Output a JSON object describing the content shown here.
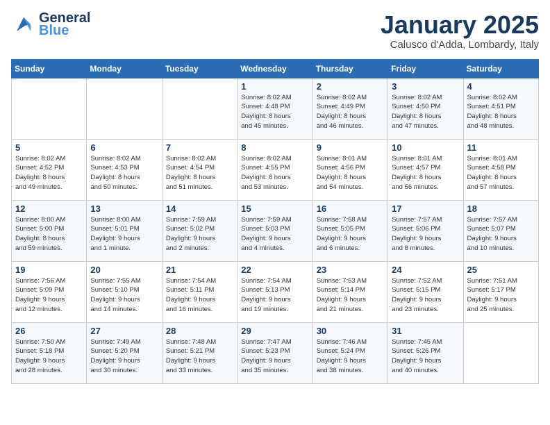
{
  "logo": {
    "line1": "General",
    "line2": "Blue",
    "bird_icon": "bird-icon"
  },
  "header": {
    "month": "January 2025",
    "location": "Calusco d'Adda, Lombardy, Italy"
  },
  "weekdays": [
    "Sunday",
    "Monday",
    "Tuesday",
    "Wednesday",
    "Thursday",
    "Friday",
    "Saturday"
  ],
  "weeks": [
    [
      {
        "day": "",
        "info": ""
      },
      {
        "day": "",
        "info": ""
      },
      {
        "day": "",
        "info": ""
      },
      {
        "day": "1",
        "info": "Sunrise: 8:02 AM\nSunset: 4:48 PM\nDaylight: 8 hours\nand 45 minutes."
      },
      {
        "day": "2",
        "info": "Sunrise: 8:02 AM\nSunset: 4:49 PM\nDaylight: 8 hours\nand 46 minutes."
      },
      {
        "day": "3",
        "info": "Sunrise: 8:02 AM\nSunset: 4:50 PM\nDaylight: 8 hours\nand 47 minutes."
      },
      {
        "day": "4",
        "info": "Sunrise: 8:02 AM\nSunset: 4:51 PM\nDaylight: 8 hours\nand 48 minutes."
      }
    ],
    [
      {
        "day": "5",
        "info": "Sunrise: 8:02 AM\nSunset: 4:52 PM\nDaylight: 8 hours\nand 49 minutes."
      },
      {
        "day": "6",
        "info": "Sunrise: 8:02 AM\nSunset: 4:53 PM\nDaylight: 8 hours\nand 50 minutes."
      },
      {
        "day": "7",
        "info": "Sunrise: 8:02 AM\nSunset: 4:54 PM\nDaylight: 8 hours\nand 51 minutes."
      },
      {
        "day": "8",
        "info": "Sunrise: 8:02 AM\nSunset: 4:55 PM\nDaylight: 8 hours\nand 53 minutes."
      },
      {
        "day": "9",
        "info": "Sunrise: 8:01 AM\nSunset: 4:56 PM\nDaylight: 8 hours\nand 54 minutes."
      },
      {
        "day": "10",
        "info": "Sunrise: 8:01 AM\nSunset: 4:57 PM\nDaylight: 8 hours\nand 56 minutes."
      },
      {
        "day": "11",
        "info": "Sunrise: 8:01 AM\nSunset: 4:58 PM\nDaylight: 8 hours\nand 57 minutes."
      }
    ],
    [
      {
        "day": "12",
        "info": "Sunrise: 8:00 AM\nSunset: 5:00 PM\nDaylight: 8 hours\nand 59 minutes."
      },
      {
        "day": "13",
        "info": "Sunrise: 8:00 AM\nSunset: 5:01 PM\nDaylight: 9 hours\nand 1 minute."
      },
      {
        "day": "14",
        "info": "Sunrise: 7:59 AM\nSunset: 5:02 PM\nDaylight: 9 hours\nand 2 minutes."
      },
      {
        "day": "15",
        "info": "Sunrise: 7:59 AM\nSunset: 5:03 PM\nDaylight: 9 hours\nand 4 minutes."
      },
      {
        "day": "16",
        "info": "Sunrise: 7:58 AM\nSunset: 5:05 PM\nDaylight: 9 hours\nand 6 minutes."
      },
      {
        "day": "17",
        "info": "Sunrise: 7:57 AM\nSunset: 5:06 PM\nDaylight: 9 hours\nand 8 minutes."
      },
      {
        "day": "18",
        "info": "Sunrise: 7:57 AM\nSunset: 5:07 PM\nDaylight: 9 hours\nand 10 minutes."
      }
    ],
    [
      {
        "day": "19",
        "info": "Sunrise: 7:56 AM\nSunset: 5:09 PM\nDaylight: 9 hours\nand 12 minutes."
      },
      {
        "day": "20",
        "info": "Sunrise: 7:55 AM\nSunset: 5:10 PM\nDaylight: 9 hours\nand 14 minutes."
      },
      {
        "day": "21",
        "info": "Sunrise: 7:54 AM\nSunset: 5:11 PM\nDaylight: 9 hours\nand 16 minutes."
      },
      {
        "day": "22",
        "info": "Sunrise: 7:54 AM\nSunset: 5:13 PM\nDaylight: 9 hours\nand 19 minutes."
      },
      {
        "day": "23",
        "info": "Sunrise: 7:53 AM\nSunset: 5:14 PM\nDaylight: 9 hours\nand 21 minutes."
      },
      {
        "day": "24",
        "info": "Sunrise: 7:52 AM\nSunset: 5:15 PM\nDaylight: 9 hours\nand 23 minutes."
      },
      {
        "day": "25",
        "info": "Sunrise: 7:51 AM\nSunset: 5:17 PM\nDaylight: 9 hours\nand 25 minutes."
      }
    ],
    [
      {
        "day": "26",
        "info": "Sunrise: 7:50 AM\nSunset: 5:18 PM\nDaylight: 9 hours\nand 28 minutes."
      },
      {
        "day": "27",
        "info": "Sunrise: 7:49 AM\nSunset: 5:20 PM\nDaylight: 9 hours\nand 30 minutes."
      },
      {
        "day": "28",
        "info": "Sunrise: 7:48 AM\nSunset: 5:21 PM\nDaylight: 9 hours\nand 33 minutes."
      },
      {
        "day": "29",
        "info": "Sunrise: 7:47 AM\nSunset: 5:23 PM\nDaylight: 9 hours\nand 35 minutes."
      },
      {
        "day": "30",
        "info": "Sunrise: 7:46 AM\nSunset: 5:24 PM\nDaylight: 9 hours\nand 38 minutes."
      },
      {
        "day": "31",
        "info": "Sunrise: 7:45 AM\nSunset: 5:26 PM\nDaylight: 9 hours\nand 40 minutes."
      },
      {
        "day": "",
        "info": ""
      }
    ]
  ]
}
